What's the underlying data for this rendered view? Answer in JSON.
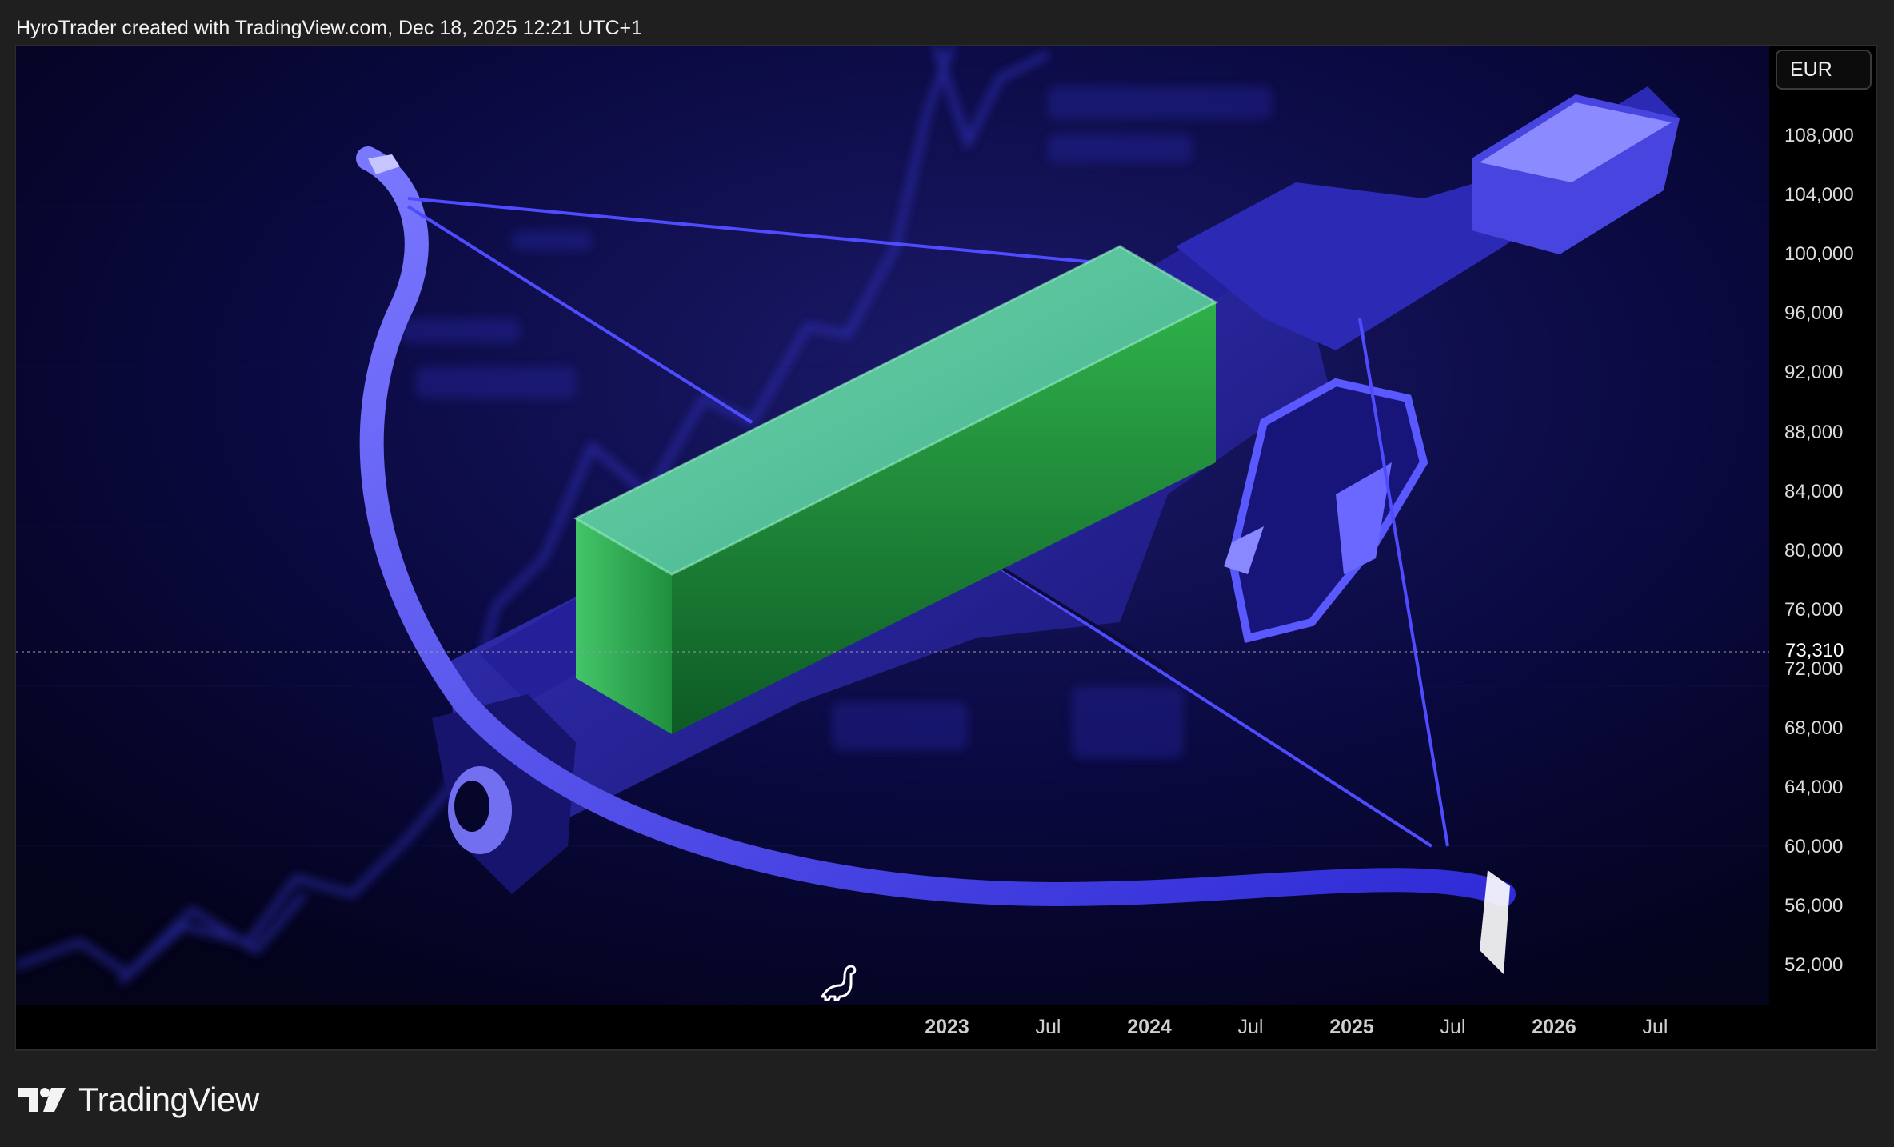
{
  "header": {
    "attribution": "HyroTrader created with TradingView.com, Dec 18, 2025 12:21 UTC+1"
  },
  "price_axis": {
    "currency": "EUR",
    "labels": [
      "108,000",
      "104,000",
      "100,000",
      "96,000",
      "92,000",
      "88,000",
      "84,000",
      "80,000",
      "76,000",
      "72,000",
      "68,000",
      "64,000",
      "60,000",
      "56,000",
      "52,000"
    ],
    "last_price": "73,310"
  },
  "time_axis": {
    "labels": [
      {
        "text": "2023",
        "bold": true
      },
      {
        "text": "Jul",
        "bold": false
      },
      {
        "text": "2024",
        "bold": true
      },
      {
        "text": "Jul",
        "bold": false
      },
      {
        "text": "2025",
        "bold": true
      },
      {
        "text": "Jul",
        "bold": false
      },
      {
        "text": "2026",
        "bold": true
      },
      {
        "text": "Jul",
        "bold": false
      }
    ]
  },
  "footer": {
    "brand": "TradingView"
  },
  "colors": {
    "background": "#1f1f1f",
    "chart_bg": "#05051e",
    "accent_blue": "#4b46ff",
    "candle_green": "#34c26a"
  }
}
